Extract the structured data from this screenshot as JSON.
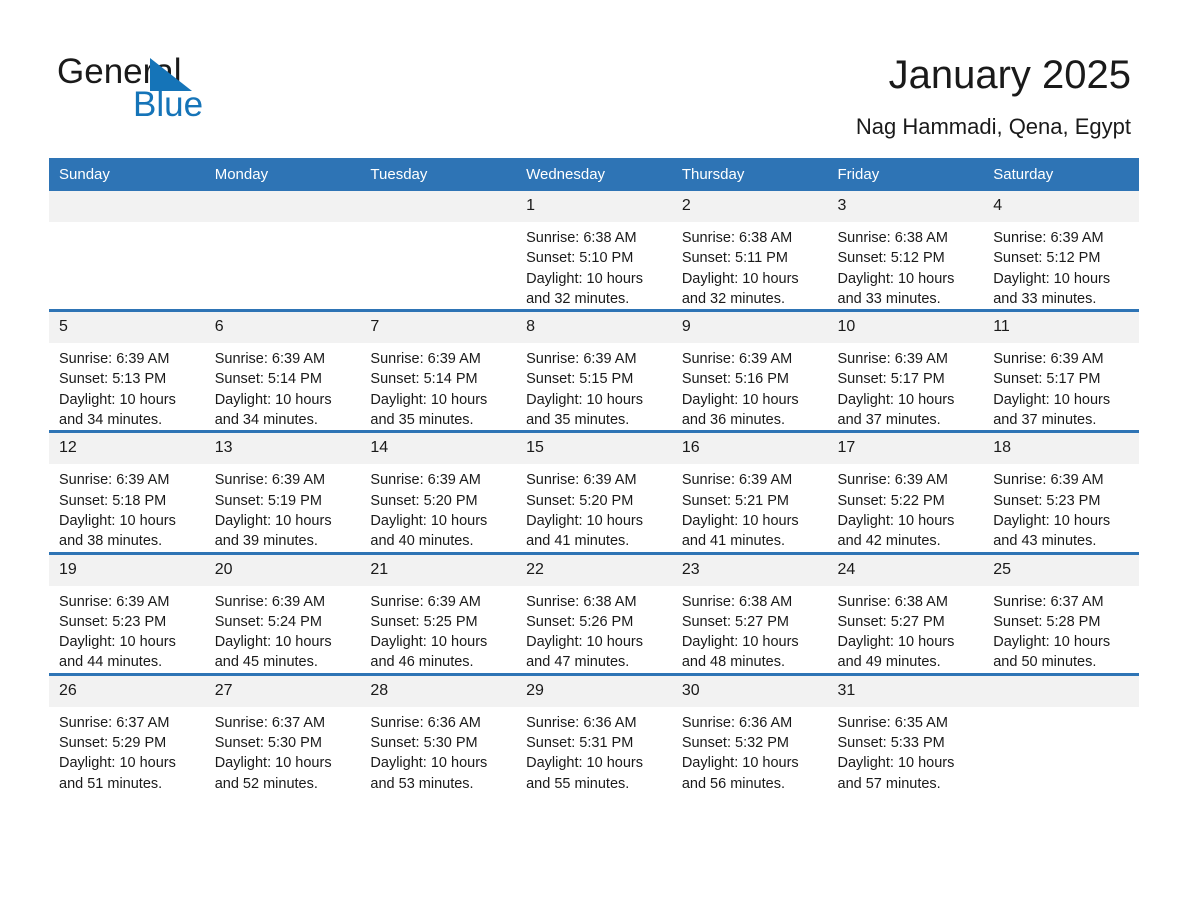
{
  "brand": {
    "name_part1": "General",
    "name_part2": "Blue",
    "triangle_icon": "triangle-icon",
    "accent_color": "#1574b8"
  },
  "header": {
    "title": "January 2025",
    "location": "Nag Hammadi, Qena, Egypt"
  },
  "theme": {
    "header_row_bg": "#2e74b5",
    "daynum_bg": "#f2f2f2",
    "page_bg": "#ffffff",
    "text_color": "#1a1a1a"
  },
  "calendar": {
    "weekday_headers": [
      "Sunday",
      "Monday",
      "Tuesday",
      "Wednesday",
      "Thursday",
      "Friday",
      "Saturday"
    ],
    "weeks": [
      [
        {
          "day": "",
          "empty": true,
          "sunrise": "",
          "sunset": "",
          "daylight1": "",
          "daylight2": ""
        },
        {
          "day": "",
          "empty": true,
          "sunrise": "",
          "sunset": "",
          "daylight1": "",
          "daylight2": ""
        },
        {
          "day": "",
          "empty": true,
          "sunrise": "",
          "sunset": "",
          "daylight1": "",
          "daylight2": ""
        },
        {
          "day": "1",
          "empty": false,
          "sunrise": "Sunrise: 6:38 AM",
          "sunset": "Sunset: 5:10 PM",
          "daylight1": "Daylight: 10 hours",
          "daylight2": "and 32 minutes."
        },
        {
          "day": "2",
          "empty": false,
          "sunrise": "Sunrise: 6:38 AM",
          "sunset": "Sunset: 5:11 PM",
          "daylight1": "Daylight: 10 hours",
          "daylight2": "and 32 minutes."
        },
        {
          "day": "3",
          "empty": false,
          "sunrise": "Sunrise: 6:38 AM",
          "sunset": "Sunset: 5:12 PM",
          "daylight1": "Daylight: 10 hours",
          "daylight2": "and 33 minutes."
        },
        {
          "day": "4",
          "empty": false,
          "sunrise": "Sunrise: 6:39 AM",
          "sunset": "Sunset: 5:12 PM",
          "daylight1": "Daylight: 10 hours",
          "daylight2": "and 33 minutes."
        }
      ],
      [
        {
          "day": "5",
          "empty": false,
          "sunrise": "Sunrise: 6:39 AM",
          "sunset": "Sunset: 5:13 PM",
          "daylight1": "Daylight: 10 hours",
          "daylight2": "and 34 minutes."
        },
        {
          "day": "6",
          "empty": false,
          "sunrise": "Sunrise: 6:39 AM",
          "sunset": "Sunset: 5:14 PM",
          "daylight1": "Daylight: 10 hours",
          "daylight2": "and 34 minutes."
        },
        {
          "day": "7",
          "empty": false,
          "sunrise": "Sunrise: 6:39 AM",
          "sunset": "Sunset: 5:14 PM",
          "daylight1": "Daylight: 10 hours",
          "daylight2": "and 35 minutes."
        },
        {
          "day": "8",
          "empty": false,
          "sunrise": "Sunrise: 6:39 AM",
          "sunset": "Sunset: 5:15 PM",
          "daylight1": "Daylight: 10 hours",
          "daylight2": "and 35 minutes."
        },
        {
          "day": "9",
          "empty": false,
          "sunrise": "Sunrise: 6:39 AM",
          "sunset": "Sunset: 5:16 PM",
          "daylight1": "Daylight: 10 hours",
          "daylight2": "and 36 minutes."
        },
        {
          "day": "10",
          "empty": false,
          "sunrise": "Sunrise: 6:39 AM",
          "sunset": "Sunset: 5:17 PM",
          "daylight1": "Daylight: 10 hours",
          "daylight2": "and 37 minutes."
        },
        {
          "day": "11",
          "empty": false,
          "sunrise": "Sunrise: 6:39 AM",
          "sunset": "Sunset: 5:17 PM",
          "daylight1": "Daylight: 10 hours",
          "daylight2": "and 37 minutes."
        }
      ],
      [
        {
          "day": "12",
          "empty": false,
          "sunrise": "Sunrise: 6:39 AM",
          "sunset": "Sunset: 5:18 PM",
          "daylight1": "Daylight: 10 hours",
          "daylight2": "and 38 minutes."
        },
        {
          "day": "13",
          "empty": false,
          "sunrise": "Sunrise: 6:39 AM",
          "sunset": "Sunset: 5:19 PM",
          "daylight1": "Daylight: 10 hours",
          "daylight2": "and 39 minutes."
        },
        {
          "day": "14",
          "empty": false,
          "sunrise": "Sunrise: 6:39 AM",
          "sunset": "Sunset: 5:20 PM",
          "daylight1": "Daylight: 10 hours",
          "daylight2": "and 40 minutes."
        },
        {
          "day": "15",
          "empty": false,
          "sunrise": "Sunrise: 6:39 AM",
          "sunset": "Sunset: 5:20 PM",
          "daylight1": "Daylight: 10 hours",
          "daylight2": "and 41 minutes."
        },
        {
          "day": "16",
          "empty": false,
          "sunrise": "Sunrise: 6:39 AM",
          "sunset": "Sunset: 5:21 PM",
          "daylight1": "Daylight: 10 hours",
          "daylight2": "and 41 minutes."
        },
        {
          "day": "17",
          "empty": false,
          "sunrise": "Sunrise: 6:39 AM",
          "sunset": "Sunset: 5:22 PM",
          "daylight1": "Daylight: 10 hours",
          "daylight2": "and 42 minutes."
        },
        {
          "day": "18",
          "empty": false,
          "sunrise": "Sunrise: 6:39 AM",
          "sunset": "Sunset: 5:23 PM",
          "daylight1": "Daylight: 10 hours",
          "daylight2": "and 43 minutes."
        }
      ],
      [
        {
          "day": "19",
          "empty": false,
          "sunrise": "Sunrise: 6:39 AM",
          "sunset": "Sunset: 5:23 PM",
          "daylight1": "Daylight: 10 hours",
          "daylight2": "and 44 minutes."
        },
        {
          "day": "20",
          "empty": false,
          "sunrise": "Sunrise: 6:39 AM",
          "sunset": "Sunset: 5:24 PM",
          "daylight1": "Daylight: 10 hours",
          "daylight2": "and 45 minutes."
        },
        {
          "day": "21",
          "empty": false,
          "sunrise": "Sunrise: 6:39 AM",
          "sunset": "Sunset: 5:25 PM",
          "daylight1": "Daylight: 10 hours",
          "daylight2": "and 46 minutes."
        },
        {
          "day": "22",
          "empty": false,
          "sunrise": "Sunrise: 6:38 AM",
          "sunset": "Sunset: 5:26 PM",
          "daylight1": "Daylight: 10 hours",
          "daylight2": "and 47 minutes."
        },
        {
          "day": "23",
          "empty": false,
          "sunrise": "Sunrise: 6:38 AM",
          "sunset": "Sunset: 5:27 PM",
          "daylight1": "Daylight: 10 hours",
          "daylight2": "and 48 minutes."
        },
        {
          "day": "24",
          "empty": false,
          "sunrise": "Sunrise: 6:38 AM",
          "sunset": "Sunset: 5:27 PM",
          "daylight1": "Daylight: 10 hours",
          "daylight2": "and 49 minutes."
        },
        {
          "day": "25",
          "empty": false,
          "sunrise": "Sunrise: 6:37 AM",
          "sunset": "Sunset: 5:28 PM",
          "daylight1": "Daylight: 10 hours",
          "daylight2": "and 50 minutes."
        }
      ],
      [
        {
          "day": "26",
          "empty": false,
          "sunrise": "Sunrise: 6:37 AM",
          "sunset": "Sunset: 5:29 PM",
          "daylight1": "Daylight: 10 hours",
          "daylight2": "and 51 minutes."
        },
        {
          "day": "27",
          "empty": false,
          "sunrise": "Sunrise: 6:37 AM",
          "sunset": "Sunset: 5:30 PM",
          "daylight1": "Daylight: 10 hours",
          "daylight2": "and 52 minutes."
        },
        {
          "day": "28",
          "empty": false,
          "sunrise": "Sunrise: 6:36 AM",
          "sunset": "Sunset: 5:30 PM",
          "daylight1": "Daylight: 10 hours",
          "daylight2": "and 53 minutes."
        },
        {
          "day": "29",
          "empty": false,
          "sunrise": "Sunrise: 6:36 AM",
          "sunset": "Sunset: 5:31 PM",
          "daylight1": "Daylight: 10 hours",
          "daylight2": "and 55 minutes."
        },
        {
          "day": "30",
          "empty": false,
          "sunrise": "Sunrise: 6:36 AM",
          "sunset": "Sunset: 5:32 PM",
          "daylight1": "Daylight: 10 hours",
          "daylight2": "and 56 minutes."
        },
        {
          "day": "31",
          "empty": false,
          "sunrise": "Sunrise: 6:35 AM",
          "sunset": "Sunset: 5:33 PM",
          "daylight1": "Daylight: 10 hours",
          "daylight2": "and 57 minutes."
        },
        {
          "day": "",
          "empty": true,
          "sunrise": "",
          "sunset": "",
          "daylight1": "",
          "daylight2": ""
        }
      ]
    ]
  }
}
